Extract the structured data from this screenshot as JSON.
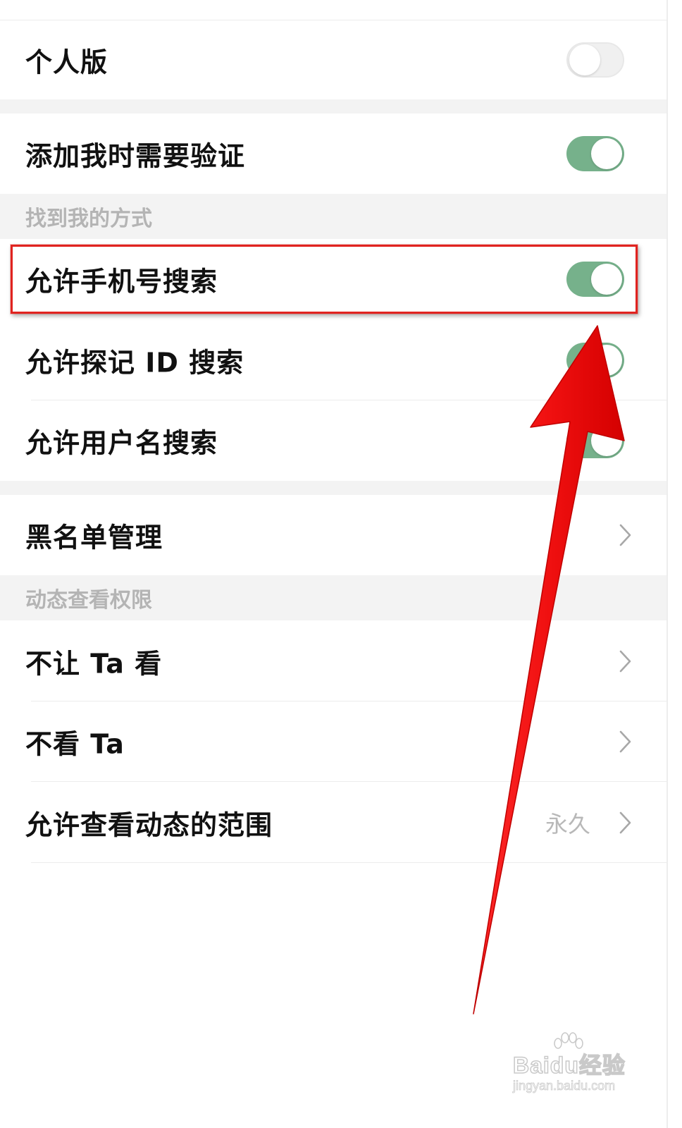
{
  "settings": {
    "personal_edition": {
      "label": "个人版",
      "enabled": false
    },
    "verify_on_add": {
      "label": "添加我时需要验证",
      "enabled": true
    },
    "find_me_section": {
      "header": "找到我的方式"
    },
    "allow_phone_search": {
      "label": "允许手机号搜索",
      "enabled": true
    },
    "allow_id_search": {
      "label": "允许探记 ID 搜索",
      "enabled": true
    },
    "allow_username_search": {
      "label": "允许用户名搜索",
      "enabled": true
    },
    "blacklist": {
      "label": "黑名单管理"
    },
    "moments_section": {
      "header": "动态查看权限"
    },
    "hide_from": {
      "label": "不让 Ta 看"
    },
    "dont_see": {
      "label": "不看 Ta"
    },
    "moments_range": {
      "label": "允许查看动态的范围",
      "value": "永久"
    }
  },
  "annotation": {
    "highlight_color": "#e0231f",
    "arrow_color": "#ff1a1a"
  },
  "watermark": {
    "logo": "Baidu经验",
    "url": "jingyan.baidu.com"
  },
  "colors": {
    "toggle_on": "#76b18b",
    "section_bg": "#f3f3f3",
    "section_text": "#b4b4b4"
  }
}
